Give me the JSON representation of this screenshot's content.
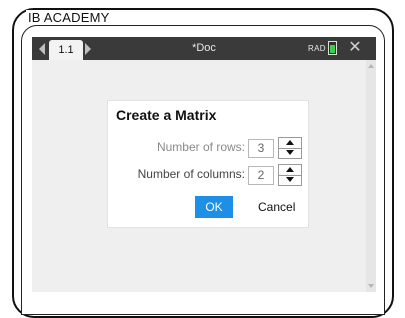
{
  "brand": {
    "name": "IB ACADEMY"
  },
  "tabbar": {
    "page_tab": "1.1",
    "doc_title": "*Doc",
    "angle_mode": "RAD",
    "close_symbol": "✕",
    "battery_level": 0.85,
    "battery_color": "#3ecf4a"
  },
  "dialog": {
    "title": "Create a Matrix",
    "rows_label": "Number of rows:",
    "rows_value": "3",
    "cols_label": "Number of columns:",
    "cols_value": "2",
    "ok_label": "OK",
    "cancel_label": "Cancel"
  },
  "colors": {
    "tabbar_bg": "#3a3a3a",
    "screen_bg": "#efefef",
    "ok_button": "#1e8fe6"
  }
}
